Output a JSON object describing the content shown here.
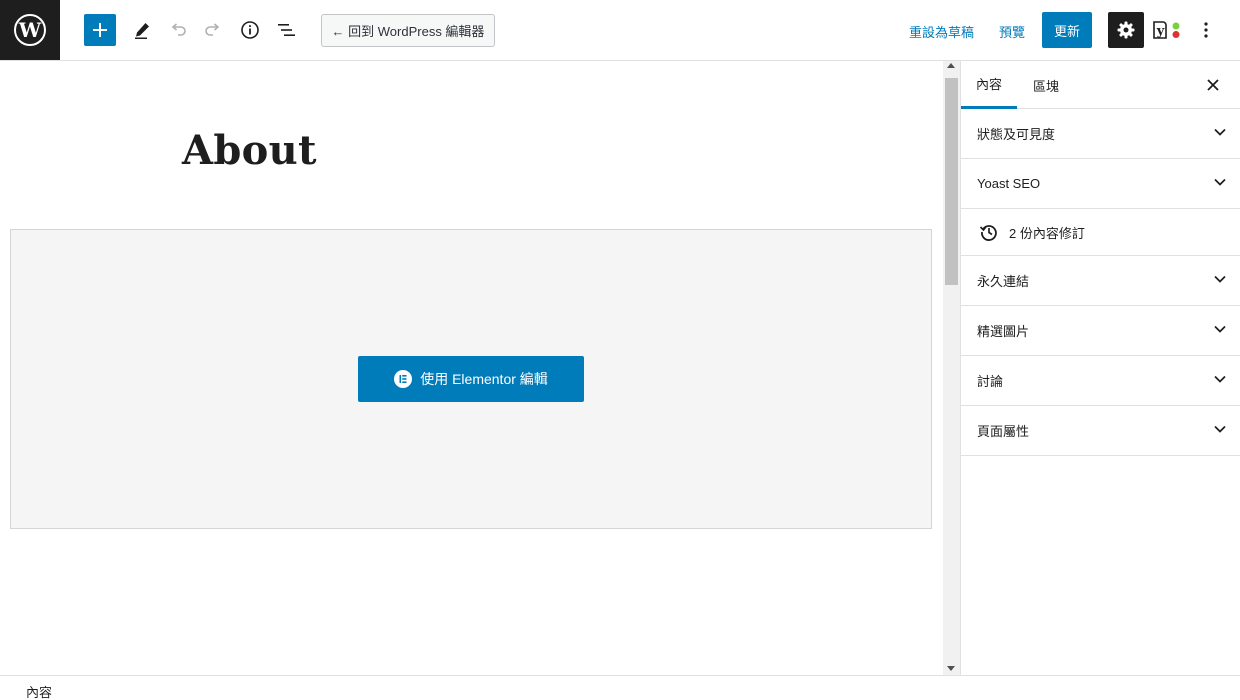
{
  "toolbar": {
    "back_label": "← 回到 WordPress 編輯器",
    "save_draft_label": "重設為草稿",
    "preview_label": "預覽",
    "update_label": "更新"
  },
  "post": {
    "title": "About",
    "elementor_button_label": "使用 Elementor 編輯"
  },
  "sidebar": {
    "tabs": [
      {
        "label": "內容",
        "active": true
      },
      {
        "label": "區塊",
        "active": false
      }
    ],
    "panels": [
      {
        "label": "狀態及可見度"
      },
      {
        "label": "Yoast SEO"
      },
      {
        "label": "2 份內容修訂"
      },
      {
        "label": "永久連結"
      },
      {
        "label": "精選圖片"
      },
      {
        "label": "討論"
      },
      {
        "label": "頁面屬性"
      }
    ]
  },
  "footer": {
    "breadcrumb": "內容"
  },
  "colors": {
    "accent": "#007cba",
    "dark": "#1e1e1e",
    "yoast_red": "#dc3232",
    "yoast_green": "#7ad03a"
  }
}
